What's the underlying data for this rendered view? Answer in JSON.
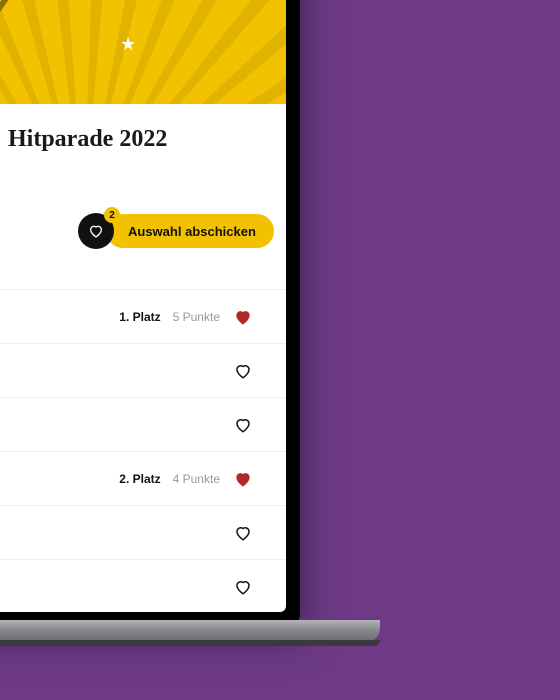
{
  "page": {
    "title": "Hitparade 2022"
  },
  "action": {
    "favorites_count": "2",
    "submit_label": "Auswahl abschicken"
  },
  "rows": [
    {
      "rank": "1. Platz",
      "points": "5 Punkte",
      "selected": true
    },
    {
      "rank": "",
      "points": "",
      "selected": false
    },
    {
      "rank": "",
      "points": "",
      "selected": false
    },
    {
      "rank": "2. Platz",
      "points": "4 Punkte",
      "selected": true
    },
    {
      "rank": "",
      "points": "",
      "selected": false
    },
    {
      "rank": "",
      "points": "",
      "selected": false
    }
  ]
}
